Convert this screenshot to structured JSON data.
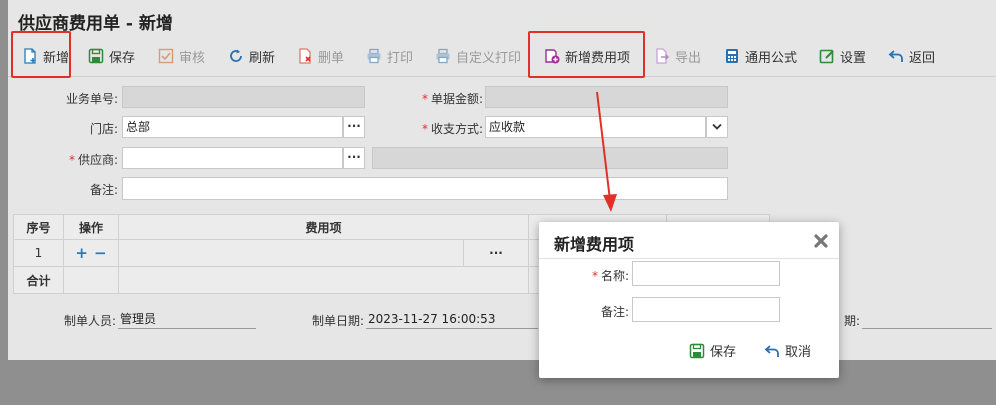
{
  "page_title": "供应商费用单 - 新增",
  "toolbar": {
    "add": "新增",
    "save": "保存",
    "audit": "审核",
    "refresh": "刷新",
    "delete": "删单",
    "print": "打印",
    "custom_print": "自定义打印",
    "add_fee_item": "新增费用项",
    "export": "导出",
    "formula": "通用公式",
    "settings": "设置",
    "back": "返回"
  },
  "form": {
    "doc_no_label": "业务单号:",
    "doc_no_value": "",
    "amount_label": "单据金额:",
    "amount_value": "",
    "store_label": "门店:",
    "store_value": "总部",
    "pay_method_label": "收支方式:",
    "pay_method_value": "应收款",
    "supplier_label": "供应商:",
    "supplier_value": "",
    "remark_label": "备注:",
    "remark_value": ""
  },
  "grid": {
    "headers": {
      "seq": "序号",
      "op": "操作",
      "fee_item": "费用项"
    },
    "row1_seq": "1",
    "plus": "+",
    "minus": "−",
    "dots": "···",
    "total": "合计"
  },
  "footer": {
    "creator_label": "制单人员:",
    "creator_value": "管理员",
    "date_label": "制单日期:",
    "date_value": "2023-11-27 16:00:53",
    "other_label": "期:"
  },
  "dialog": {
    "title": "新增费用项",
    "name_label": "名称:",
    "remark_label": "备注:",
    "save": "保存",
    "cancel": "取消"
  },
  "colors": {
    "highlight": "#e0302a",
    "accent_blue": "#2a7ab8",
    "accent_green": "#2e8b3a"
  }
}
